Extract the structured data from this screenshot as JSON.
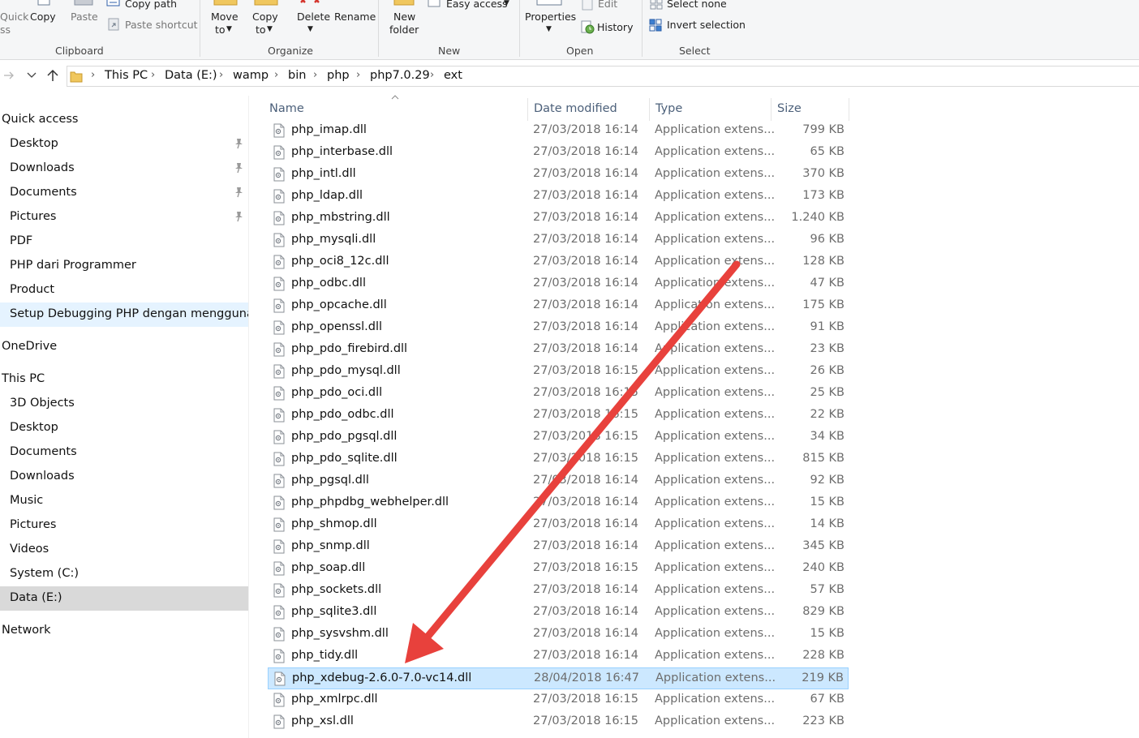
{
  "ribbon": {
    "clipboard": {
      "quick_access_partial_1": "Quick",
      "quick_access_partial_2": "ss",
      "copy": "Copy",
      "paste": "Paste",
      "copy_path": "Copy path",
      "paste_shortcut": "Paste shortcut",
      "group": "Clipboard"
    },
    "organize": {
      "move_to_1": "Move",
      "move_to_2": "to",
      "copy_to_1": "Copy",
      "copy_to_2": "to",
      "delete": "Delete",
      "rename": "Rename",
      "group": "Organize"
    },
    "new": {
      "new_folder_1": "New",
      "new_folder_2": "folder",
      "easy_access": "Easy access",
      "group": "New"
    },
    "open": {
      "properties": "Properties",
      "edit": "Edit",
      "history": "History",
      "group": "Open"
    },
    "select": {
      "select_none": "Select none",
      "invert_selection": "Invert selection",
      "group": "Select"
    }
  },
  "address": {
    "crumbs": [
      "This PC",
      "Data (E:)",
      "wamp",
      "bin",
      "php",
      "php7.0.29",
      "ext"
    ]
  },
  "nav": {
    "items": [
      {
        "label": "Quick access",
        "indent": false,
        "pinned": false,
        "state": ""
      },
      {
        "label": "Desktop",
        "indent": true,
        "pinned": true,
        "state": ""
      },
      {
        "label": "Downloads",
        "indent": true,
        "pinned": true,
        "state": ""
      },
      {
        "label": "Documents",
        "indent": true,
        "pinned": true,
        "state": ""
      },
      {
        "label": "Pictures",
        "indent": true,
        "pinned": true,
        "state": ""
      },
      {
        "label": "PDF",
        "indent": true,
        "pinned": false,
        "state": ""
      },
      {
        "label": "PHP dari Programmer",
        "indent": true,
        "pinned": false,
        "state": ""
      },
      {
        "label": "Product",
        "indent": true,
        "pinned": false,
        "state": ""
      },
      {
        "label": "Setup Debugging PHP dengan menggunakan",
        "indent": true,
        "pinned": false,
        "state": "hover"
      },
      {
        "label": "OneDrive",
        "indent": false,
        "pinned": false,
        "state": ""
      },
      {
        "label": "This PC",
        "indent": false,
        "pinned": false,
        "state": ""
      },
      {
        "label": "3D Objects",
        "indent": true,
        "pinned": false,
        "state": ""
      },
      {
        "label": "Desktop",
        "indent": true,
        "pinned": false,
        "state": ""
      },
      {
        "label": "Documents",
        "indent": true,
        "pinned": false,
        "state": ""
      },
      {
        "label": "Downloads",
        "indent": true,
        "pinned": false,
        "state": ""
      },
      {
        "label": "Music",
        "indent": true,
        "pinned": false,
        "state": ""
      },
      {
        "label": "Pictures",
        "indent": true,
        "pinned": false,
        "state": ""
      },
      {
        "label": "Videos",
        "indent": true,
        "pinned": false,
        "state": ""
      },
      {
        "label": "System (C:)",
        "indent": true,
        "pinned": false,
        "state": ""
      },
      {
        "label": "Data (E:)",
        "indent": true,
        "pinned": false,
        "state": "selected"
      },
      {
        "label": "Network",
        "indent": false,
        "pinned": false,
        "state": ""
      }
    ]
  },
  "columns": {
    "name": "Name",
    "date": "Date modified",
    "type": "Type",
    "size": "Size"
  },
  "files": [
    {
      "name": "php_imap.dll",
      "date": "27/03/2018 16:14",
      "type": "Application extens...",
      "size": "799 KB"
    },
    {
      "name": "php_interbase.dll",
      "date": "27/03/2018 16:14",
      "type": "Application extens...",
      "size": "65 KB"
    },
    {
      "name": "php_intl.dll",
      "date": "27/03/2018 16:14",
      "type": "Application extens...",
      "size": "370 KB"
    },
    {
      "name": "php_ldap.dll",
      "date": "27/03/2018 16:14",
      "type": "Application extens...",
      "size": "173 KB"
    },
    {
      "name": "php_mbstring.dll",
      "date": "27/03/2018 16:14",
      "type": "Application extens...",
      "size": "1.240 KB"
    },
    {
      "name": "php_mysqli.dll",
      "date": "27/03/2018 16:14",
      "type": "Application extens...",
      "size": "96 KB"
    },
    {
      "name": "php_oci8_12c.dll",
      "date": "27/03/2018 16:14",
      "type": "Application extens...",
      "size": "128 KB"
    },
    {
      "name": "php_odbc.dll",
      "date": "27/03/2018 16:14",
      "type": "Application extens...",
      "size": "47 KB"
    },
    {
      "name": "php_opcache.dll",
      "date": "27/03/2018 16:14",
      "type": "Application extens...",
      "size": "175 KB"
    },
    {
      "name": "php_openssl.dll",
      "date": "27/03/2018 16:14",
      "type": "Application extens...",
      "size": "91 KB"
    },
    {
      "name": "php_pdo_firebird.dll",
      "date": "27/03/2018 16:14",
      "type": "Application extens...",
      "size": "23 KB"
    },
    {
      "name": "php_pdo_mysql.dll",
      "date": "27/03/2018 16:15",
      "type": "Application extens...",
      "size": "26 KB"
    },
    {
      "name": "php_pdo_oci.dll",
      "date": "27/03/2018 16:15",
      "type": "Application extens...",
      "size": "25 KB"
    },
    {
      "name": "php_pdo_odbc.dll",
      "date": "27/03/2018 16:15",
      "type": "Application extens...",
      "size": "22 KB"
    },
    {
      "name": "php_pdo_pgsql.dll",
      "date": "27/03/2018 16:15",
      "type": "Application extens...",
      "size": "34 KB"
    },
    {
      "name": "php_pdo_sqlite.dll",
      "date": "27/03/2018 16:15",
      "type": "Application extens...",
      "size": "815 KB"
    },
    {
      "name": "php_pgsql.dll",
      "date": "27/03/2018 16:14",
      "type": "Application extens...",
      "size": "92 KB"
    },
    {
      "name": "php_phpdbg_webhelper.dll",
      "date": "27/03/2018 16:14",
      "type": "Application extens...",
      "size": "15 KB"
    },
    {
      "name": "php_shmop.dll",
      "date": "27/03/2018 16:14",
      "type": "Application extens...",
      "size": "14 KB"
    },
    {
      "name": "php_snmp.dll",
      "date": "27/03/2018 16:14",
      "type": "Application extens...",
      "size": "345 KB"
    },
    {
      "name": "php_soap.dll",
      "date": "27/03/2018 16:15",
      "type": "Application extens...",
      "size": "240 KB"
    },
    {
      "name": "php_sockets.dll",
      "date": "27/03/2018 16:14",
      "type": "Application extens...",
      "size": "57 KB"
    },
    {
      "name": "php_sqlite3.dll",
      "date": "27/03/2018 16:14",
      "type": "Application extens...",
      "size": "829 KB"
    },
    {
      "name": "php_sysvshm.dll",
      "date": "27/03/2018 16:14",
      "type": "Application extens...",
      "size": "15 KB"
    },
    {
      "name": "php_tidy.dll",
      "date": "27/03/2018 16:14",
      "type": "Application extens...",
      "size": "228 KB"
    },
    {
      "name": "php_xdebug-2.6.0-7.0-vc14.dll",
      "date": "28/04/2018 16:47",
      "type": "Application extens...",
      "size": "219 KB",
      "selected": true
    },
    {
      "name": "php_xmlrpc.dll",
      "date": "27/03/2018 16:15",
      "type": "Application extens...",
      "size": "67 KB"
    },
    {
      "name": "php_xsl.dll",
      "date": "27/03/2018 16:15",
      "type": "Application extens...",
      "size": "223 KB"
    }
  ],
  "colors": {
    "annotation_arrow": "#e8413c",
    "selection_bg": "#cce8ff",
    "selection_border": "#99d1ff"
  }
}
